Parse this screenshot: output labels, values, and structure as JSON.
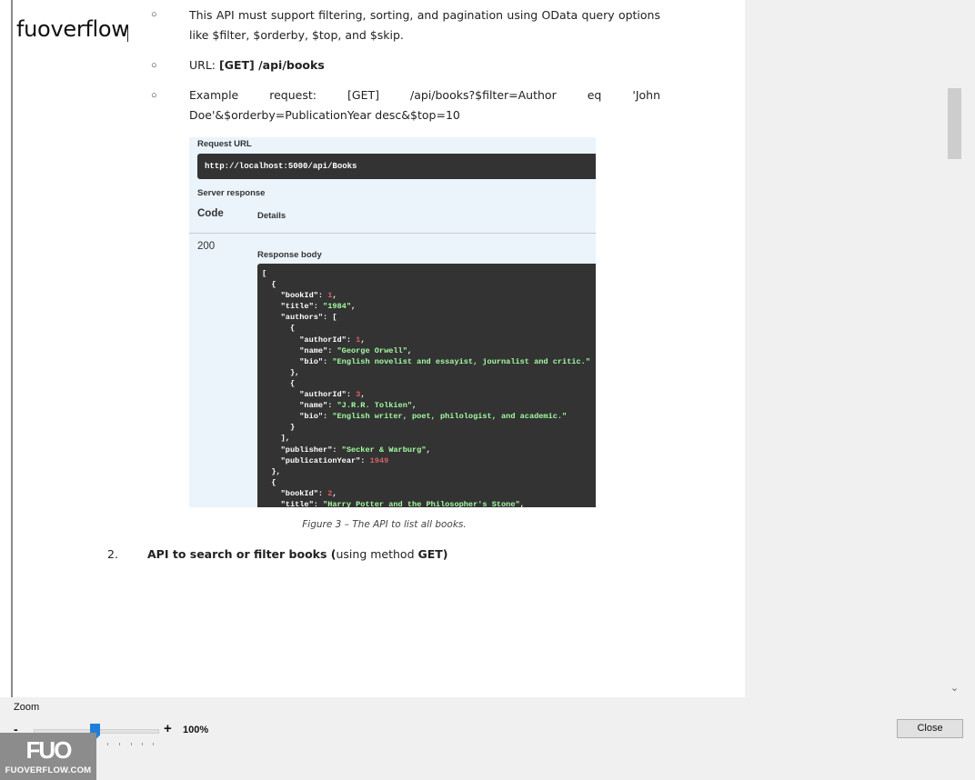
{
  "brand": {
    "name": "fuoverflow"
  },
  "document": {
    "bullets": [
      {
        "text": "This API must support filtering, sorting, and pagination using OData query options like $filter, $orderby, $top, and $skip."
      },
      {
        "prefix": "URL: ",
        "bold": "[GET] /api/books"
      },
      {
        "text": "Example request: [GET] /api/books?$filter=Author eq 'John Doe'&$orderby=PublicationYear desc&$top=10"
      }
    ],
    "bullet_symbol": "○",
    "figure": {
      "request_url_label": "Request URL",
      "request_url": "http://localhost:5000/api/Books",
      "server_response_label": "Server response",
      "code_header": "Code",
      "details_header": "Details",
      "status_code": "200",
      "response_body_label": "Response body",
      "response_lines": [
        [
          {
            "t": "["
          }
        ],
        [
          {
            "t": "  {"
          }
        ],
        [
          {
            "t": "    \"bookId\": "
          },
          {
            "t": "1",
            "c": "n"
          },
          {
            "t": ","
          }
        ],
        [
          {
            "t": "    \"title\": "
          },
          {
            "t": "\"1984\"",
            "c": "s"
          },
          {
            "t": ","
          }
        ],
        [
          {
            "t": "    \"authors\": ["
          }
        ],
        [
          {
            "t": "      {"
          }
        ],
        [
          {
            "t": "        \"authorId\": "
          },
          {
            "t": "1",
            "c": "n"
          },
          {
            "t": ","
          }
        ],
        [
          {
            "t": "        \"name\": "
          },
          {
            "t": "\"George Orwell\"",
            "c": "s"
          },
          {
            "t": ","
          }
        ],
        [
          {
            "t": "        \"bio\": "
          },
          {
            "t": "\"English novelist and essayist, journalist and critic.\"",
            "c": "s"
          }
        ],
        [
          {
            "t": "      },"
          }
        ],
        [
          {
            "t": "      {"
          }
        ],
        [
          {
            "t": "        \"authorId\": "
          },
          {
            "t": "3",
            "c": "n"
          },
          {
            "t": ","
          }
        ],
        [
          {
            "t": "        \"name\": "
          },
          {
            "t": "\"J.R.R. Tolkien\"",
            "c": "s"
          },
          {
            "t": ","
          }
        ],
        [
          {
            "t": "        \"bio\": "
          },
          {
            "t": "\"English writer, poet, philologist, and academic.\"",
            "c": "s"
          }
        ],
        [
          {
            "t": "      }"
          }
        ],
        [
          {
            "t": "    ],"
          }
        ],
        [
          {
            "t": "    \"publisher\": "
          },
          {
            "t": "\"Secker & Warburg\"",
            "c": "s"
          },
          {
            "t": ","
          }
        ],
        [
          {
            "t": "    \"publicationYear\": "
          },
          {
            "t": "1949",
            "c": "n"
          }
        ],
        [
          {
            "t": "  },"
          }
        ],
        [
          {
            "t": "  {"
          }
        ],
        [
          {
            "t": "    \"bookId\": "
          },
          {
            "t": "2",
            "c": "n"
          },
          {
            "t": ","
          }
        ],
        [
          {
            "t": "    \"title\": "
          },
          {
            "t": "\"Harry Potter and the Philosopher's Stone\"",
            "c": "s"
          },
          {
            "t": ","
          }
        ]
      ],
      "caption": "Figure 3 – The API to list all books."
    },
    "item2": {
      "number": "2.",
      "bold": "API to search or filter books (",
      "normal": "using method ",
      "bold_end": "GET)"
    }
  },
  "zoom": {
    "label": "Zoom",
    "minus": "-",
    "plus": "+",
    "value": "100%",
    "level_percent": 100
  },
  "close_button": {
    "label": "Close"
  },
  "watermark": {
    "logo": "FUO",
    "text": "FUOVERFLOW.COM"
  },
  "colors": {
    "slider_thumb": "#1f7fd8",
    "code_bg": "#333333",
    "string": "#a2fca2",
    "number": "#d36363",
    "figure_bg": "#ebf3fb"
  }
}
